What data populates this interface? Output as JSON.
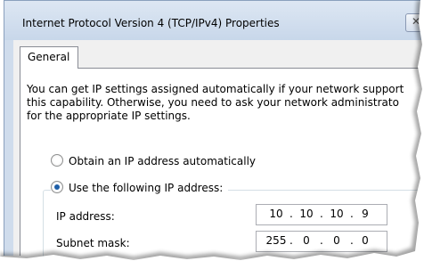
{
  "window": {
    "title": "Internet Protocol Version 4 (TCP/IPv4) Properties",
    "close_glyph": "✕"
  },
  "tabs": [
    {
      "label": "General"
    }
  ],
  "general": {
    "description_line1": "You can get IP settings assigned automatically if your network support",
    "description_line2": "this capability. Otherwise, you need to ask your network administrato",
    "description_line3": "for the appropriate IP settings.",
    "radio_auto": {
      "label": "Obtain an IP address automatically",
      "checked": false
    },
    "radio_manual": {
      "label": "Use the following IP address:",
      "checked": true
    },
    "fields": [
      {
        "label": "IP address:",
        "octets": [
          "10",
          "10",
          "10",
          "9"
        ]
      },
      {
        "label": "Subnet mask:",
        "octets": [
          "255",
          "0",
          "0",
          "0"
        ]
      }
    ]
  },
  "colors": {
    "title_bar": "#cfdcec",
    "radio_dot": "#1f5fa8",
    "background": "#ffffff"
  },
  "icons": {
    "close": "close-icon"
  }
}
